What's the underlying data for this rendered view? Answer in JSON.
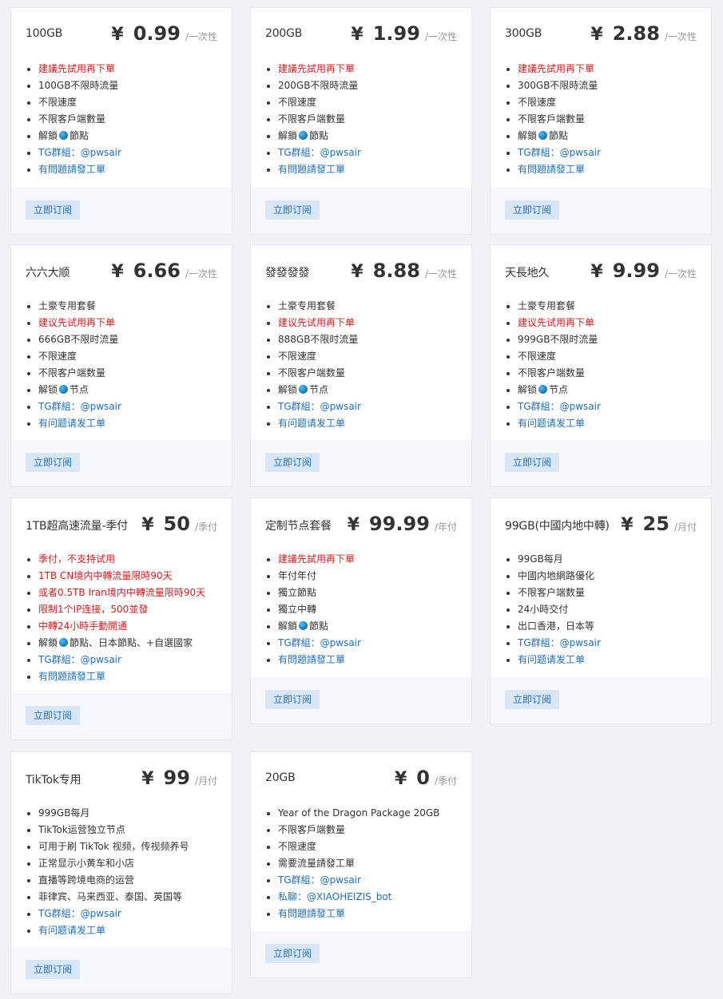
{
  "subscribe_label": "立即订阅",
  "plans": [
    {
      "name": "100GB",
      "price": "0.99",
      "currency": "¥",
      "period": "/一次性",
      "features": [
        {
          "text": "建議先試用再下單",
          "style": "red"
        },
        {
          "text": "100GB不限時流量",
          "style": ""
        },
        {
          "text": "不限速度",
          "style": ""
        },
        {
          "text": "不限客戶端數量",
          "style": ""
        },
        {
          "text": "解鎖",
          "suffix": "節點",
          "globe": true,
          "style": ""
        },
        {
          "text": "TG群組：@pwsair",
          "style": "blue"
        },
        {
          "text": "有問題請發工單",
          "style": "blue"
        }
      ]
    },
    {
      "name": "200GB",
      "price": "1.99",
      "currency": "¥",
      "period": "/一次性",
      "features": [
        {
          "text": "建議先試用再下單",
          "style": "red"
        },
        {
          "text": "200GB不限時流量",
          "style": ""
        },
        {
          "text": "不限速度",
          "style": ""
        },
        {
          "text": "不限客戶端數量",
          "style": ""
        },
        {
          "text": "解鎖",
          "suffix": "節點",
          "globe": true,
          "style": ""
        },
        {
          "text": "TG群組：@pwsair",
          "style": "blue"
        },
        {
          "text": "有問題請發工單",
          "style": "blue"
        }
      ]
    },
    {
      "name": "300GB",
      "price": "2.88",
      "currency": "¥",
      "period": "/一次性",
      "features": [
        {
          "text": "建議先試用再下單",
          "style": "red"
        },
        {
          "text": "300GB不限時流量",
          "style": ""
        },
        {
          "text": "不限速度",
          "style": ""
        },
        {
          "text": "不限客戶端數量",
          "style": ""
        },
        {
          "text": "解鎖",
          "suffix": "節點",
          "globe": true,
          "style": ""
        },
        {
          "text": "TG群組：@pwsair",
          "style": "blue"
        },
        {
          "text": "有問題請發工單",
          "style": "blue"
        }
      ]
    },
    {
      "name": "六六大顺",
      "price": "6.66",
      "currency": "¥",
      "period": "/一次性",
      "features": [
        {
          "text": "土豪专用套餐",
          "style": ""
        },
        {
          "text": "建议先试用再下单",
          "style": "red"
        },
        {
          "text": "666GB不限时流量",
          "style": ""
        },
        {
          "text": "不限速度",
          "style": ""
        },
        {
          "text": "不限客户端数量",
          "style": ""
        },
        {
          "text": "解锁",
          "suffix": "节点",
          "globe": true,
          "style": ""
        },
        {
          "text": "TG群組：@pwsair",
          "style": "blue"
        },
        {
          "text": "有问题请发工单",
          "style": "blue"
        }
      ]
    },
    {
      "name": "發發發發",
      "price": "8.88",
      "currency": "¥",
      "period": "/一次性",
      "features": [
        {
          "text": "土豪专用套餐",
          "style": ""
        },
        {
          "text": "建议先试用再下单",
          "style": "red"
        },
        {
          "text": "888GB不限时流量",
          "style": ""
        },
        {
          "text": "不限速度",
          "style": ""
        },
        {
          "text": "不限客户端数量",
          "style": ""
        },
        {
          "text": "解锁",
          "suffix": "节点",
          "globe": true,
          "style": ""
        },
        {
          "text": "TG群組：@pwsair",
          "style": "blue"
        },
        {
          "text": "有问题请发工单",
          "style": "blue"
        }
      ]
    },
    {
      "name": "天長地久",
      "price": "9.99",
      "currency": "¥",
      "period": "/一次性",
      "features": [
        {
          "text": "土豪专用套餐",
          "style": ""
        },
        {
          "text": "建议先试用再下单",
          "style": "red"
        },
        {
          "text": "999GB不限时流量",
          "style": ""
        },
        {
          "text": "不限速度",
          "style": ""
        },
        {
          "text": "不限客户端数量",
          "style": ""
        },
        {
          "text": "解锁",
          "suffix": "节点",
          "globe": true,
          "style": ""
        },
        {
          "text": "TG群組：@pwsair",
          "style": "blue"
        },
        {
          "text": "有问题请发工单",
          "style": "blue"
        }
      ]
    },
    {
      "name": "1TB超高速流量-季付",
      "price": "50",
      "currency": "¥",
      "period": "/季付",
      "features": [
        {
          "text": "季付，不支持试用",
          "style": "red"
        },
        {
          "text": "1TB CN境内中轉流量限時90天",
          "style": "red"
        },
        {
          "text": "或者0.5TB Iran境内中轉流量限時90天",
          "style": "red"
        },
        {
          "text": "限制1个IP连接，500並發",
          "style": "red"
        },
        {
          "text": "中轉24小時手動開通",
          "style": "red"
        },
        {
          "text": "解鎖",
          "suffix": "節點、日本節點、+自選國家",
          "globe": true,
          "style": ""
        },
        {
          "text": "TG群組：@pwsair",
          "style": "blue"
        },
        {
          "text": "有問題請發工單",
          "style": "blue"
        }
      ]
    },
    {
      "name": "定制节点套餐",
      "price": "99.99",
      "currency": "¥",
      "period": "/年付",
      "features": [
        {
          "text": "建議先試用再下單",
          "style": "red"
        },
        {
          "text": "年付年付",
          "style": ""
        },
        {
          "text": "獨立節點",
          "style": ""
        },
        {
          "text": "獨立中轉",
          "style": ""
        },
        {
          "text": "解鎖",
          "suffix": "節點",
          "globe": true,
          "style": ""
        },
        {
          "text": "TG群組：@pwsair",
          "style": "blue"
        },
        {
          "text": "有問題請發工單",
          "style": "blue"
        }
      ]
    },
    {
      "name": "99GB(中國内地中轉)",
      "price": "25",
      "currency": "¥",
      "period": "/月付",
      "features": [
        {
          "text": "99GB每月",
          "style": ""
        },
        {
          "text": "中國内地網路優化",
          "style": ""
        },
        {
          "text": "不限客户端数量",
          "style": ""
        },
        {
          "text": "24小時交付",
          "style": ""
        },
        {
          "text": "出口香港，日本等",
          "style": ""
        },
        {
          "text": "TG群組：@pwsair",
          "style": "blue"
        },
        {
          "text": "有问题请发工单",
          "style": "blue"
        }
      ]
    },
    {
      "name": "TikTok专用",
      "price": "99",
      "currency": "¥",
      "period": "/月付",
      "features": [
        {
          "text": "999GB每月",
          "style": ""
        },
        {
          "text": "TikTok运营独立节点",
          "style": ""
        },
        {
          "text": "可用于刷 TikTok 视频，传视频养号",
          "style": ""
        },
        {
          "text": "正常显示小黄车和小店",
          "style": ""
        },
        {
          "text": "直播等跨境电商的运营",
          "style": ""
        },
        {
          "text": "菲律宾、马来西亚、泰国、英国等",
          "style": ""
        },
        {
          "text": "TG群組：@pwsair",
          "style": "blue"
        },
        {
          "text": "有问题请发工单",
          "style": "blue"
        }
      ]
    },
    {
      "name": "20GB",
      "price": "0",
      "currency": "¥",
      "period": "/季付",
      "features": [
        {
          "text": "Year of the Dragon Package 20GB",
          "style": ""
        },
        {
          "text": "不限客戶端數量",
          "style": ""
        },
        {
          "text": "不限速度",
          "style": ""
        },
        {
          "text": "需要流量請發工單",
          "style": ""
        },
        {
          "text": "TG群組：@pwsair",
          "style": "blue"
        },
        {
          "text": "私聊：@XIAOHEIZIS_bot",
          "style": "blue"
        },
        {
          "text": "有問題請發工單",
          "style": "blue"
        }
      ]
    }
  ]
}
